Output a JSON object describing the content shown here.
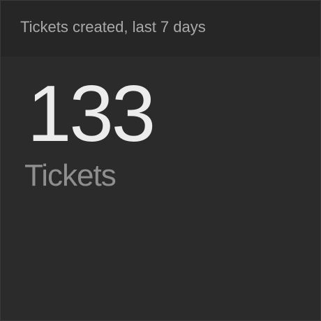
{
  "widget": {
    "title": "Tickets created, last 7 days",
    "value": "133",
    "unit": "Tickets"
  }
}
